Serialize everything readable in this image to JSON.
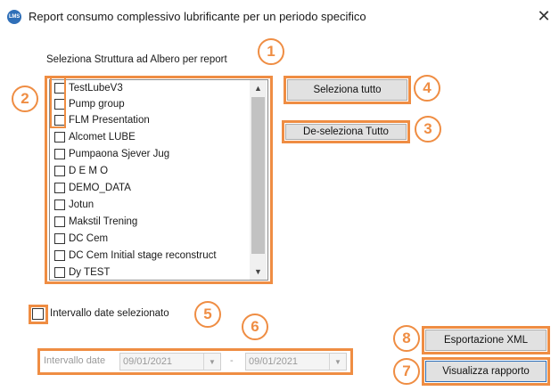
{
  "window": {
    "title": "Report consumo complessivo lubrificante per un periodo specifico",
    "app_icon_text": "LMS",
    "close_glyph": "✕"
  },
  "tree": {
    "label": "Seleziona Struttura ad Albero per report",
    "items": [
      {
        "label": "TestLubeV3",
        "checked": false
      },
      {
        "label": "Pump group",
        "checked": false
      },
      {
        "label": "FLM Presentation",
        "checked": false
      },
      {
        "label": "Alcomet LUBE",
        "checked": false
      },
      {
        "label": "Pumpaona Sjever Jug",
        "checked": false
      },
      {
        "label": "D E M O",
        "checked": false
      },
      {
        "label": "DEMO_DATA",
        "checked": false
      },
      {
        "label": "Jotun",
        "checked": false
      },
      {
        "label": "Makstil Trening",
        "checked": false
      },
      {
        "label": "DC Cem",
        "checked": false
      },
      {
        "label": "DC Cem Initial stage reconstruct",
        "checked": false
      },
      {
        "label": "Dy TEST",
        "checked": false
      }
    ],
    "scroll_up_glyph": "▲",
    "scroll_down_glyph": "▼"
  },
  "buttons": {
    "select_all": "Seleziona tutto",
    "deselect_all": "De-seleziona Tutto",
    "export_xml": "Esportazione XML",
    "show_report": "Visualizza rapporto"
  },
  "date_filter": {
    "checkbox_label": "Intervallo date selezionato",
    "checked": false,
    "range_label": "Intervallo date",
    "start_date": "09/01/2021",
    "separator": "-",
    "end_date": "09/01/2021",
    "dropdown_glyph": "▼"
  },
  "annotations": {
    "n1": "1",
    "n2": "2",
    "n3": "3",
    "n4": "4",
    "n5": "5",
    "n6": "6",
    "n7": "7",
    "n8": "8"
  },
  "colors": {
    "annotation_accent": "#ef8d43",
    "button_face": "#e1e1e1",
    "icon_blue": "#2f6fb8"
  },
  "icons": {
    "app": "lms-logo-icon",
    "close": "close-icon",
    "scroll_up": "chevron-up-icon",
    "scroll_down": "chevron-down-icon",
    "dropdown": "chevron-down-icon"
  }
}
